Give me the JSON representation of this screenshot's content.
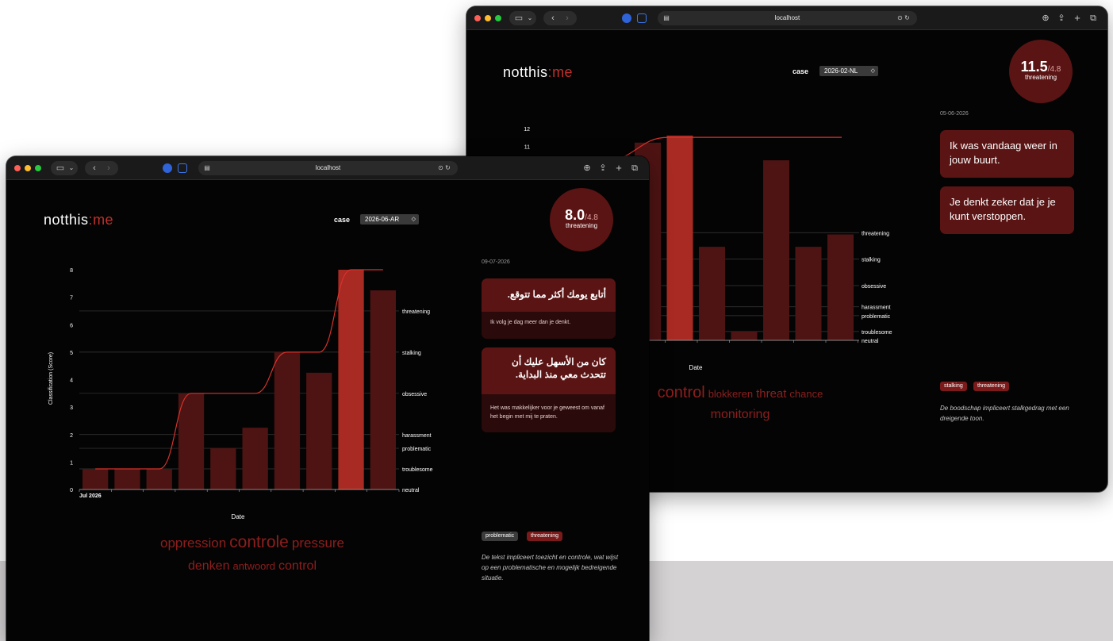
{
  "browser": {
    "url": "localhost"
  },
  "app": {
    "logo_part1": "notthis",
    "logo_sep": ":",
    "logo_part2": "me",
    "case_label": "case"
  },
  "colors": {
    "background": "#040404",
    "bar": "#4e1313",
    "bar_highlight": "#a82a23",
    "line": "#d8322b",
    "score_circle": "#5a1414",
    "accent": "#c0302b"
  },
  "back": {
    "case_value": "2026-02-NL",
    "score": {
      "value": "11.5",
      "max": "/4.8",
      "label": "threatening"
    },
    "date": "05-06-2026",
    "messages": [
      {
        "original": "Ik was vandaag weer in jouw buurt."
      },
      {
        "original": "Je denkt zeker dat je je kunt verstoppen."
      }
    ],
    "tags": [
      "stalking",
      "threatening"
    ],
    "note": "De boodschap impliceert stalkgedrag met een dreigende toon.",
    "wordcloud": {
      "line1": [
        {
          "word": "control",
          "size": 20
        },
        {
          "word": "blokkeren",
          "size": 13
        },
        {
          "word": "threat",
          "size": 15
        },
        {
          "word": "chance",
          "size": 13
        }
      ],
      "line2": [
        {
          "word": "monitoring",
          "size": 16
        }
      ]
    },
    "chart_data": {
      "type": "bar",
      "xlabel": "Date",
      "ylabel": "",
      "y_tick_labels": [
        "10",
        "11",
        "12"
      ],
      "category_labels": [
        "neutral",
        "troublesome",
        "problematic",
        "harassment",
        "obsessive",
        "stalking",
        "threatening"
      ],
      "values": [
        11.2,
        11.6,
        5.3,
        0.5,
        10.2,
        5.3,
        6.0
      ],
      "highlight_index": 1,
      "ylim": [
        0,
        12
      ]
    }
  },
  "front": {
    "case_value": "2026-06-AR",
    "score": {
      "value": "8.0",
      "max": "/4.8",
      "label": "threatening"
    },
    "date": "09-07-2026",
    "messages": [
      {
        "original": "أتابع يومك أكثر مما تتوقع.",
        "translation": "Ik volg je dag meer dan je denkt."
      },
      {
        "original": "كان من الأسهل عليك أن تتحدث معي منذ البداية.",
        "translation": "Het was makkelijker voor je geweest om vanaf het begin met mij te praten."
      }
    ],
    "tags": [
      "problematic",
      "threatening"
    ],
    "note": "De tekst impliceert toezicht en controle, wat wijst op een problematische en mogelijk bedreigende situatie.",
    "wordcloud": {
      "line1": [
        {
          "word": "oppression",
          "size": 17
        },
        {
          "word": "controle",
          "size": 21
        },
        {
          "word": "pressure",
          "size": 17
        }
      ],
      "line2": [
        {
          "word": "denken",
          "size": 16
        },
        {
          "word": "antwoord",
          "size": 13
        },
        {
          "word": "control",
          "size": 16
        }
      ]
    },
    "chart_data": {
      "type": "bar",
      "xlabel": "Date",
      "ylabel": "Classification (Score)",
      "x_tick_label": "Jul 2026",
      "y_ticks": [
        0,
        1,
        2,
        3,
        4,
        5,
        6,
        7,
        8
      ],
      "category_labels": [
        "neutral",
        "troublesome",
        "problematic",
        "harassment",
        "obsessive",
        "stalking",
        "threatening"
      ],
      "values": [
        0.75,
        0.75,
        0.75,
        3.5,
        1.5,
        2.25,
        5.0,
        4.25,
        8.0,
        7.25
      ],
      "highlight_index": 8,
      "ylim": [
        0,
        8
      ]
    }
  }
}
